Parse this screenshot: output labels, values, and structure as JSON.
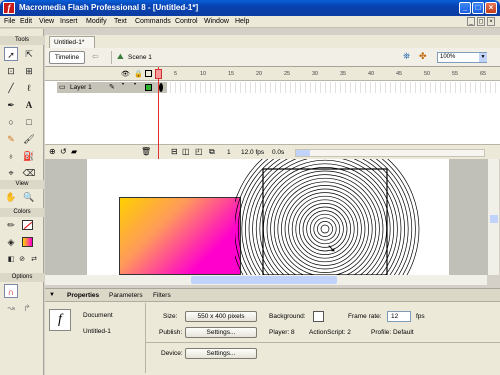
{
  "window": {
    "title": "Macromedia Flash Professional 8 - [Untitled-1*]",
    "minimize_glyph": "_",
    "maximize_glyph": "□",
    "close_glyph": "×"
  },
  "menu": {
    "items": [
      "File",
      "Edit",
      "View",
      "Insert",
      "Modify",
      "Text",
      "Commands",
      "Control",
      "Window",
      "Help"
    ],
    "doc_minimize_glyph": "_",
    "doc_restore_glyph": "◻",
    "doc_close_glyph": "×"
  },
  "tools": {
    "header": "Tools",
    "view_header": "View",
    "colors_header": "Colors",
    "options_header": "Options"
  },
  "document": {
    "tab_label": "Untitled-1*",
    "timeline_button": "Timeline",
    "scene_label": "Scene 1",
    "zoom_value": "100%"
  },
  "timeline": {
    "frame_numbers": [
      "1",
      "5",
      "10",
      "15",
      "20",
      "25",
      "30",
      "35",
      "40",
      "45",
      "50",
      "55",
      "60",
      "65"
    ],
    "layer_name": "Layer 1",
    "current_frame": "1",
    "frame_rate": "12.0 fps",
    "elapsed_time": "0.0s"
  },
  "properties": {
    "tabs": [
      "Properties",
      "Parameters",
      "Filters"
    ],
    "doc_type": "Document",
    "doc_name": "Untitled-1",
    "size_label": "Size:",
    "size_value": "550 x 400 pixels",
    "background_label": "Background:",
    "frame_rate_label": "Frame rate:",
    "frame_rate_value": "12",
    "fps_label": "fps",
    "publish_label": "Publish:",
    "settings_button": "Settings...",
    "player_label": "Player: 8",
    "actionscript_label": "ActionScript: 2",
    "profile_label": "Profile: Default",
    "device_label": "Device:",
    "device_settings_button": "Settings..."
  },
  "colors": {
    "titlebar": "#0842b0",
    "gradient_start": "#ffd400",
    "gradient_end": "#ff00cc",
    "playhead": "#e03030",
    "layer_selected": "#c5c2b8"
  }
}
